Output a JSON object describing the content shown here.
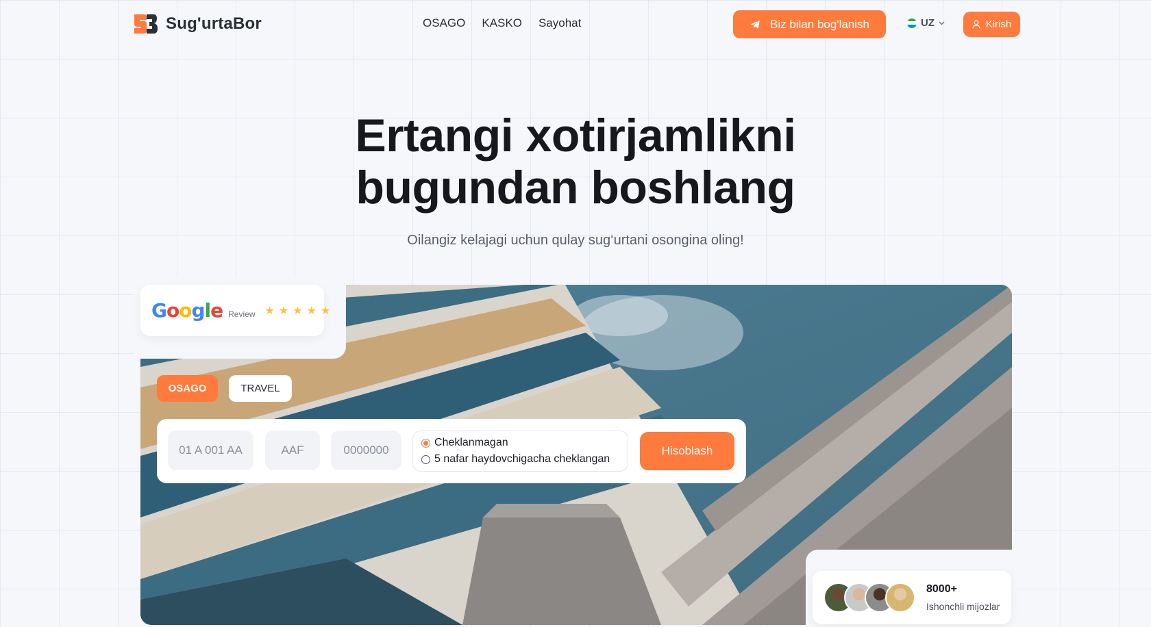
{
  "header": {
    "brand": "Sug'urtaBor",
    "nav": [
      "OSAGO",
      "KASKO",
      "Sayohat"
    ],
    "contact_label": "Biz bilan bog'lanish",
    "lang": "UZ",
    "login_label": "Kirish"
  },
  "hero": {
    "title_line1": "Ertangi xotirjamlikni",
    "title_line2": "bugundan boshlang",
    "subtitle": "Oilangiz kelajagi uchun qulay sug‘urtani osongina oling!"
  },
  "google": {
    "word": "Google",
    "review": "Review"
  },
  "tabs": {
    "osago": "OSAGO",
    "travel": "TRAVEL"
  },
  "form": {
    "plate_placeholder": "01 A 001 AA",
    "series_placeholder": "AAF",
    "number_placeholder": "0000000",
    "options": [
      "Cheklanmagan",
      "5 nafar haydovchigacha cheklangan"
    ],
    "selected": "Cheklanmagan",
    "submit": "Hisoblash"
  },
  "clients": {
    "count": "8000+",
    "label": "Ishonchli mijozlar"
  },
  "colors": {
    "accent": "#ff7a3d",
    "background": "#f5f7fb"
  }
}
